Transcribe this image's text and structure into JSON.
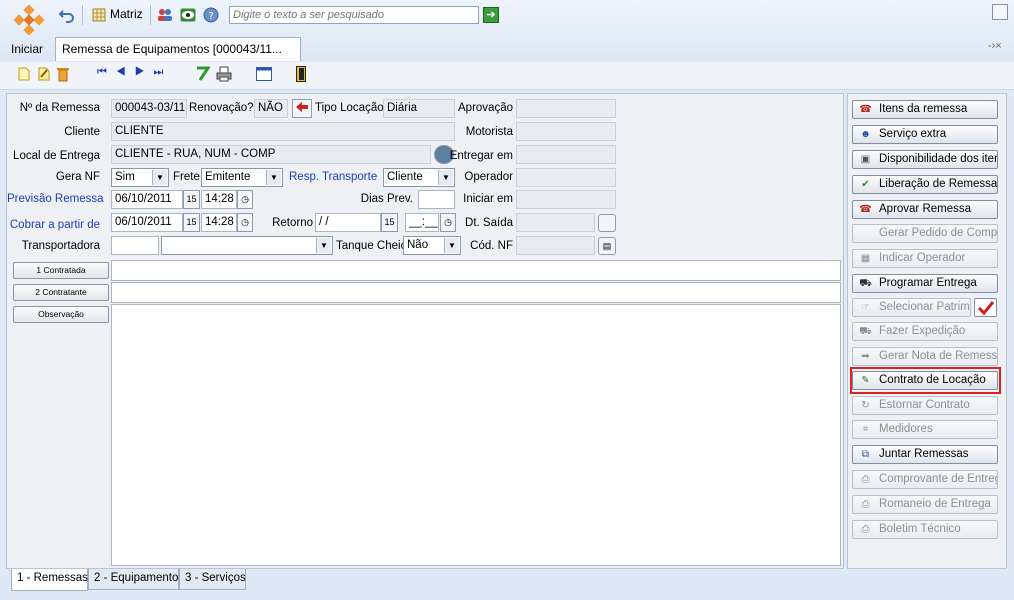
{
  "topbar": {
    "start_label": "Iniciar",
    "company_label": "Matriz",
    "search_placeholder": "Digite o texto a ser pesquisado"
  },
  "doc_tab": {
    "title": "Remessa de Equipamentos [000043/11..."
  },
  "form": {
    "labels": {
      "numero": "Nº da Remessa",
      "renovacao": "Renovação?",
      "tipo_locacao": "Tipo Locação",
      "aprovacao": "Aprovação",
      "cliente": "Cliente",
      "motorista": "Motorista",
      "local_entrega": "Local de Entrega",
      "entregar_em": "Entregar em",
      "gera_nf": "Gera NF",
      "frete": "Frete",
      "resp_transporte": "Resp. Transporte",
      "operador": "Operador",
      "previsao": "Previsão Remessa",
      "dias_prev": "Dias Prev.",
      "iniciar_em": "Iniciar em",
      "cobrar": "Cobrar a partir de",
      "retorno": "Retorno",
      "dt_saida": "Dt. Saída",
      "transportadora": "Transportadora",
      "tanque_cheio": "Tanque Cheio",
      "cod_nf": "Cód. NF"
    },
    "values": {
      "numero": "000043-03/11",
      "renovacao": "NÃO",
      "tipo_locacao": "Diária",
      "cliente": "CLIENTE",
      "local_entrega": "CLIENTE - RUA, NUM - COMP",
      "gera_nf": "Sim",
      "frete": "Emitente",
      "resp_transporte": "Cliente",
      "previsao_data": "06/10/2011",
      "previsao_hora": "14:28",
      "cobrar_data": "06/10/2011",
      "cobrar_hora": "14:28",
      "retorno_data": " / /",
      "retorno_hora": "__:__",
      "tanque_cheio": "Não"
    },
    "buttons": {
      "contratada": "1 Contratada",
      "contratante": "2 Contratante",
      "observacao": "Observação"
    }
  },
  "actions": [
    {
      "label": "Itens da remessa",
      "enabled": true,
      "icon": "phone-icon"
    },
    {
      "label": "Serviço extra",
      "enabled": true,
      "icon": "worker-icon"
    },
    {
      "label": "Disponibilidade dos itens",
      "enabled": true,
      "icon": "clipboard-icon"
    },
    {
      "label": "Liberação de Remessa",
      "enabled": true,
      "icon": "check-icon"
    },
    {
      "label": "Aprovar Remessa",
      "enabled": true,
      "icon": "phone-icon"
    },
    {
      "label": "Gerar Pedido de Compra",
      "enabled": false,
      "icon": ""
    },
    {
      "label": "Indicar Operador",
      "enabled": false,
      "icon": "grid-icon"
    },
    {
      "label": "Programar Entrega",
      "enabled": true,
      "icon": "truck-icon"
    },
    {
      "label": "Selecionar Patrim.",
      "enabled": false,
      "icon": "pointer-icon"
    },
    {
      "label": "Fazer Expedição",
      "enabled": false,
      "icon": "truck-icon"
    },
    {
      "label": "Gerar Nota de Remessa",
      "enabled": false,
      "icon": "arrow-doc-icon"
    },
    {
      "label": "Contrato de Locação",
      "enabled": true,
      "icon": "contract-icon"
    },
    {
      "label": "Estornar Contrato",
      "enabled": false,
      "icon": "refresh-icon"
    },
    {
      "label": "Medidores",
      "enabled": false,
      "icon": "meter-icon"
    },
    {
      "label": "Juntar Remessas",
      "enabled": true,
      "icon": "join-icon"
    },
    {
      "label": "Comprovante de Entrega",
      "enabled": false,
      "icon": "printer-icon"
    },
    {
      "label": "Romaneio de Entrega",
      "enabled": false,
      "icon": "printer-icon"
    },
    {
      "label": "Boletim Técnico",
      "enabled": false,
      "icon": "printer-icon"
    }
  ],
  "bottom_tabs": [
    {
      "label": "1 - Remessas",
      "active": true
    },
    {
      "label": "2 - Equipamentos",
      "active": false
    },
    {
      "label": "3 - Serviços",
      "active": false
    }
  ],
  "colors": {
    "highlight": "#e02020",
    "link_blue": "#1b3fb8",
    "bg": "#dfe9f5"
  }
}
